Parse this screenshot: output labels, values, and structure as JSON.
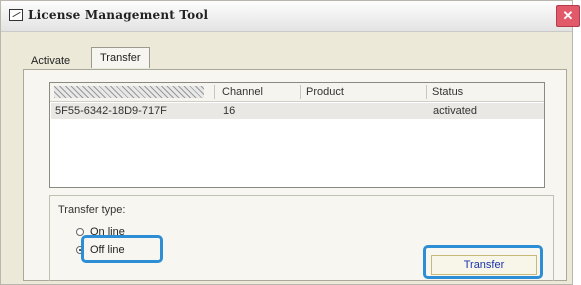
{
  "window": {
    "title": "License Management Tool",
    "close_glyph": "✕"
  },
  "tabs": [
    {
      "label": "Activate"
    },
    {
      "label": "Transfer"
    }
  ],
  "list": {
    "columns": [
      "Channel",
      "Product",
      "Status"
    ],
    "rows": [
      {
        "serial": "5F55-6342-18D9-717F",
        "channel": "16",
        "product": "",
        "status": "activated"
      }
    ]
  },
  "transfer_type": {
    "label": "Transfer type:",
    "options": [
      {
        "label": "On line",
        "checked": false
      },
      {
        "label": "Off line",
        "checked": true
      }
    ]
  },
  "button": {
    "label": "Transfer"
  },
  "colors": {
    "highlight": "#2d8ed6",
    "close_button": "#e25a6a"
  }
}
